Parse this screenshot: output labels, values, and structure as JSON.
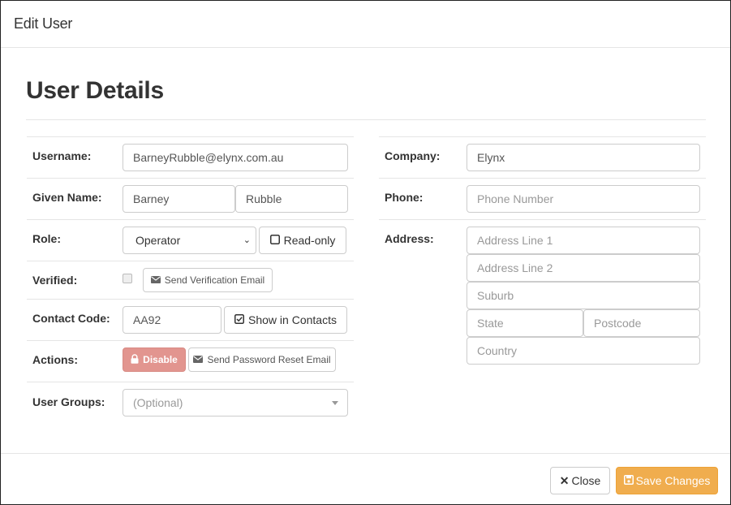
{
  "modal": {
    "title": "Edit User"
  },
  "section": {
    "title": "User Details"
  },
  "left": {
    "username": {
      "label": "Username:",
      "value": "BarneyRubble@elynx.com.au"
    },
    "given_name": {
      "label": "Given Name:",
      "first": "Barney",
      "last": "Rubble"
    },
    "role": {
      "label": "Role:",
      "selected": "Operator",
      "readonly_label": "Read-only"
    },
    "verified": {
      "label": "Verified:",
      "send_label": "Send Verification Email"
    },
    "contact_code": {
      "label": "Contact Code:",
      "value": "AA92",
      "show_label": "Show in Contacts"
    },
    "actions": {
      "label": "Actions:",
      "disable_label": "Disable",
      "reset_label": "Send Password Reset Email"
    },
    "user_groups": {
      "label": "User Groups:",
      "placeholder": "(Optional)"
    }
  },
  "right": {
    "company": {
      "label": "Company:",
      "value": "Elynx"
    },
    "phone": {
      "label": "Phone:",
      "placeholder": "Phone Number"
    },
    "address": {
      "label": "Address:",
      "line1": "Address Line 1",
      "line2": "Address Line 2",
      "suburb": "Suburb",
      "state": "State",
      "postcode": "Postcode",
      "country": "Country"
    }
  },
  "footer": {
    "close_label": "Close",
    "save_label": "Save Changes"
  },
  "icons": {
    "envelope": "envelope-icon",
    "lock": "lock-icon",
    "checkbox": "checkbox-icon",
    "close": "close-icon",
    "save": "save-icon",
    "caret": "caret-down-icon",
    "chevron": "chevron-down-icon"
  },
  "colors": {
    "danger": "#e2958f",
    "warning": "#f0ad4e",
    "border": "#cccccc"
  }
}
